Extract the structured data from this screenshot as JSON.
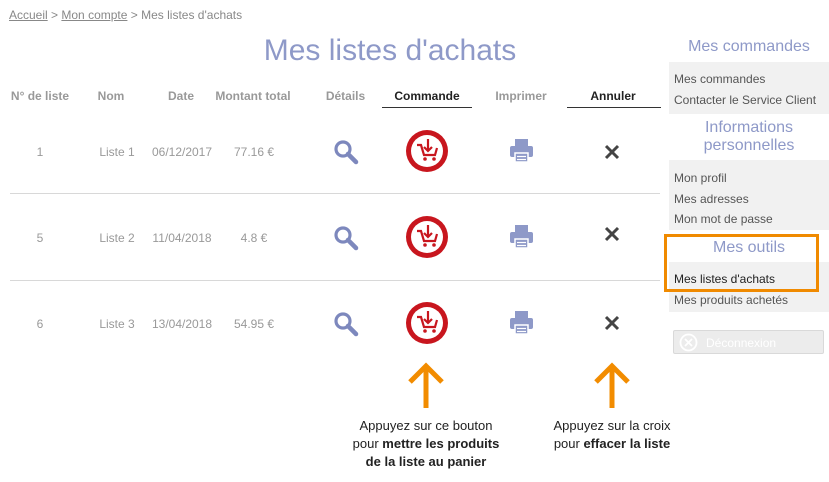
{
  "breadcrumb": {
    "home": "Accueil",
    "sep1": ">",
    "account": "Mon compte",
    "sep2": ">",
    "current": "Mes listes d'achats"
  },
  "title": "Mes listes d'achats",
  "table": {
    "headers": [
      "N° de liste",
      "Nom",
      "Date",
      "Montant total",
      "Détails",
      "Commande",
      "Imprimer",
      "Annuler"
    ],
    "rows": [
      {
        "num": "1",
        "name": "Liste 1",
        "date": "06/12/2017",
        "amount": "77.16 €"
      },
      {
        "num": "5",
        "name": "Liste 2",
        "date": "11/04/2018",
        "amount": "4.8 €"
      },
      {
        "num": "6",
        "name": "Liste 3",
        "date": "13/04/2018",
        "amount": "54.95 €"
      }
    ]
  },
  "sidebar": {
    "orders_title": "Mes commandes",
    "orders_items": [
      "Mes commandes",
      "Contacter le Service Client"
    ],
    "info_title_1": "Informations",
    "info_title_2": "personnelles",
    "info_items": [
      "Mon profil",
      "Mes adresses",
      "Mon mot de passe"
    ],
    "tools_title": "Mes outils",
    "tools_items": [
      "Mes listes d'achats",
      "Mes produits achetés"
    ],
    "logout": "Déconnexion"
  },
  "callouts": {
    "cart_l1": "Appuyez sur ce bouton",
    "cart_l2a": "pour ",
    "cart_l2b": "mettre les produits",
    "cart_l3": "de la liste au panier",
    "delete_l1": "Appuyez sur la croix",
    "delete_l2a": "pour ",
    "delete_l2b": "effacer la liste"
  },
  "colors": {
    "accent": "#8e99c8",
    "cart_red": "#c8161e",
    "highlight": "#f08a00",
    "arrow": "#f28c00"
  },
  "icons": {
    "details": "search-icon",
    "order": "cart-download-icon",
    "print": "printer-icon",
    "cancel": "close-icon",
    "logout": "close-circle-icon"
  }
}
